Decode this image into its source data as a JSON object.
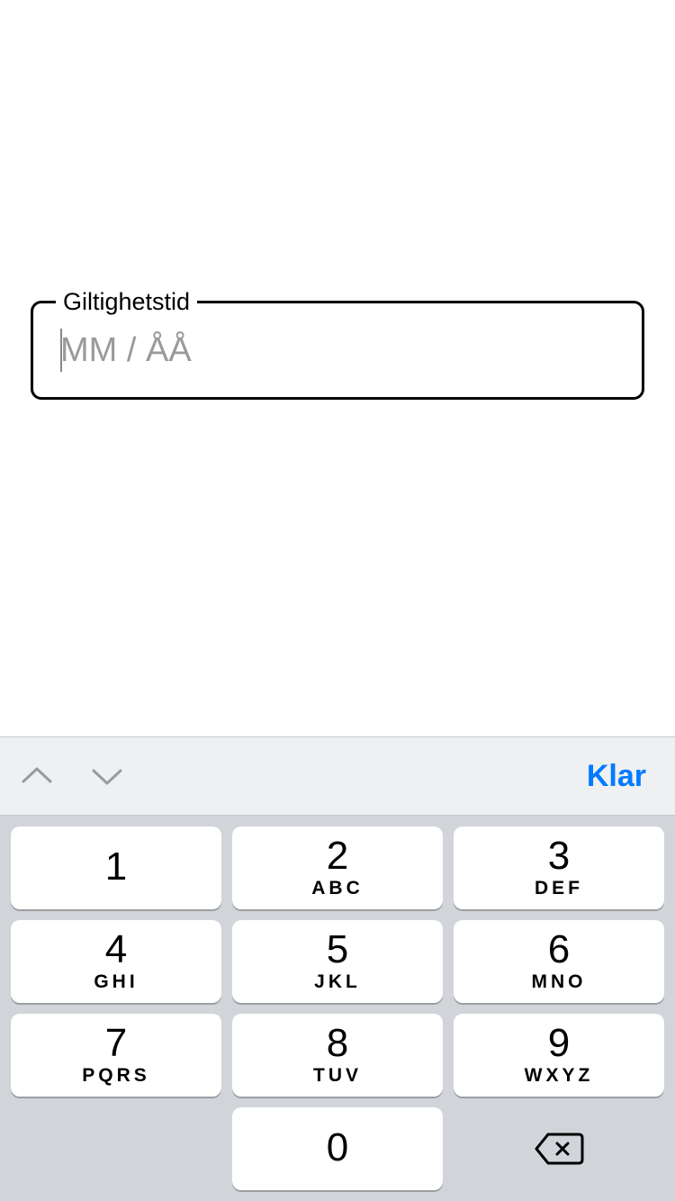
{
  "form": {
    "expiry": {
      "label": "Giltighetstid",
      "placeholder": "MM / ÅÅ",
      "value": ""
    }
  },
  "accessoryBar": {
    "doneLabel": "Klar"
  },
  "keypad": {
    "keys": [
      {
        "number": "1",
        "letters": ""
      },
      {
        "number": "2",
        "letters": "ABC"
      },
      {
        "number": "3",
        "letters": "DEF"
      },
      {
        "number": "4",
        "letters": "GHI"
      },
      {
        "number": "5",
        "letters": "JKL"
      },
      {
        "number": "6",
        "letters": "MNO"
      },
      {
        "number": "7",
        "letters": "PQRS"
      },
      {
        "number": "8",
        "letters": "TUV"
      },
      {
        "number": "9",
        "letters": "WXYZ"
      },
      {
        "number": "0",
        "letters": ""
      }
    ]
  }
}
